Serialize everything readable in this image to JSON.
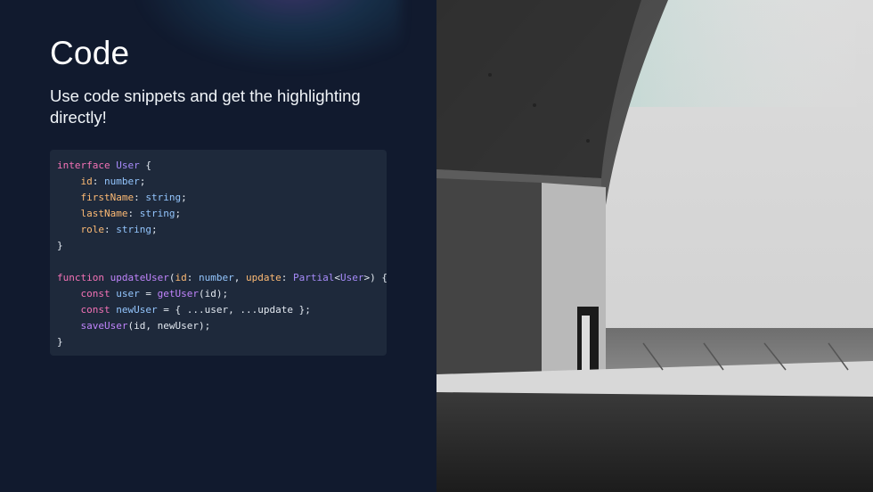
{
  "slide": {
    "title": "Code",
    "subtitle": "Use code snippets and get the highlighting directly!"
  },
  "code_block": {
    "language": "typescript",
    "lines": [
      "interface User {",
      "    id: number;",
      "    firstName: string;",
      "    lastName: string;",
      "    role: string;",
      "}",
      "",
      "function updateUser(id: number, update: Partial<User>) {",
      "    const user = getUser(id);",
      "    const newUser = { ...user, ...update };",
      "    saveUser(id, newUser);",
      "}"
    ]
  },
  "colors": {
    "background": "#111a2e",
    "code_background": "#1e293b",
    "keyword": "#f472b6",
    "type": "#a78bfa",
    "property": "#fdba74",
    "builtin_type": "#93c5fd"
  },
  "image": {
    "icon": "architecture-photo"
  }
}
